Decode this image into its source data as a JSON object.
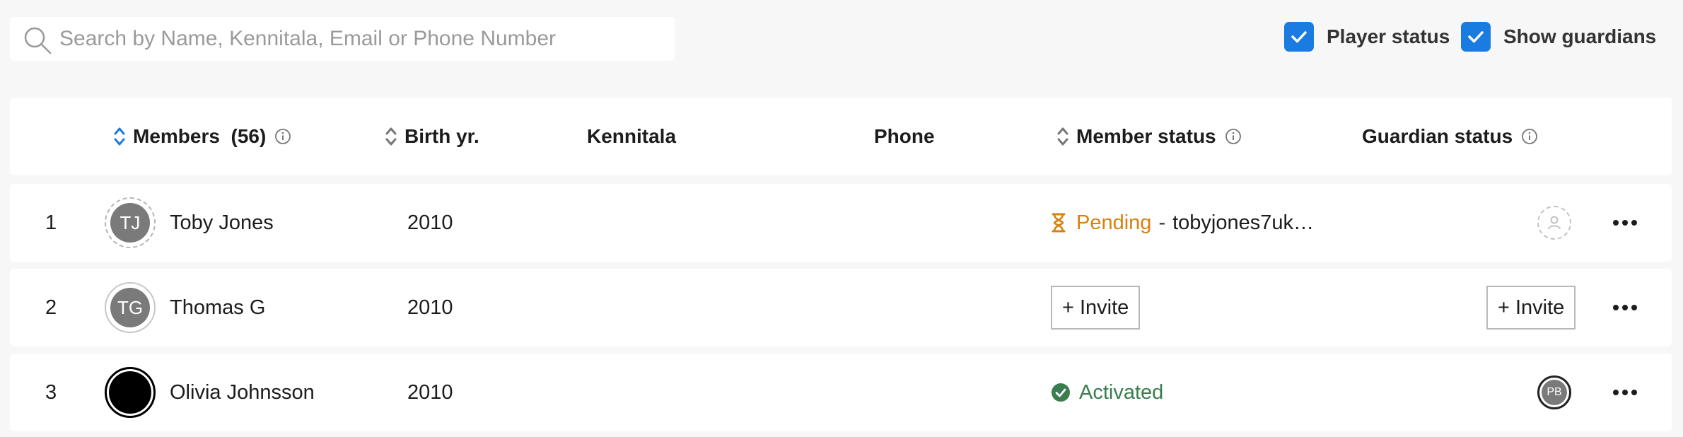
{
  "search": {
    "placeholder": "Search by Name, Kennitala, Email or Phone Number",
    "value": ""
  },
  "toggles": {
    "player_status": {
      "label": "Player status",
      "checked": true
    },
    "show_guardians": {
      "label": "Show guardians",
      "checked": true
    }
  },
  "table": {
    "headers": {
      "members": "Members",
      "members_count": "(56)",
      "birth_year": "Birth yr.",
      "kennitala": "Kennitala",
      "phone": "Phone",
      "member_status": "Member status",
      "guardian_status": "Guardian status"
    },
    "rows": [
      {
        "index": "1",
        "initials": "TJ",
        "name": "Toby Jones",
        "birth_year": "2010",
        "kennitala": "",
        "phone": "",
        "status": "Pending",
        "status_separator": "-",
        "status_detail": "tobyjones7uk…",
        "guardian": "empty-avatar"
      },
      {
        "index": "2",
        "initials": "TG",
        "name": "Thomas G",
        "birth_year": "2010",
        "kennitala": "",
        "phone": "",
        "invite_label": "+ Invite",
        "guardian_invite_label": "+ Invite"
      },
      {
        "index": "3",
        "initials": "",
        "name": "Olivia Johnsson",
        "birth_year": "2010",
        "kennitala": "",
        "phone": "",
        "status": "Activated",
        "guardian_initials": "PB"
      }
    ]
  },
  "colors": {
    "accent": "#1a7be0",
    "pending": "#d6820f",
    "activated": "#3a7d4e",
    "background": "#f7f7f7"
  },
  "icons": [
    "search-icon",
    "checkbox-checked-icon",
    "sort-icon",
    "info-icon",
    "hourglass-icon",
    "check-circle-icon",
    "person-outline-icon",
    "more-horizontal-icon"
  ]
}
